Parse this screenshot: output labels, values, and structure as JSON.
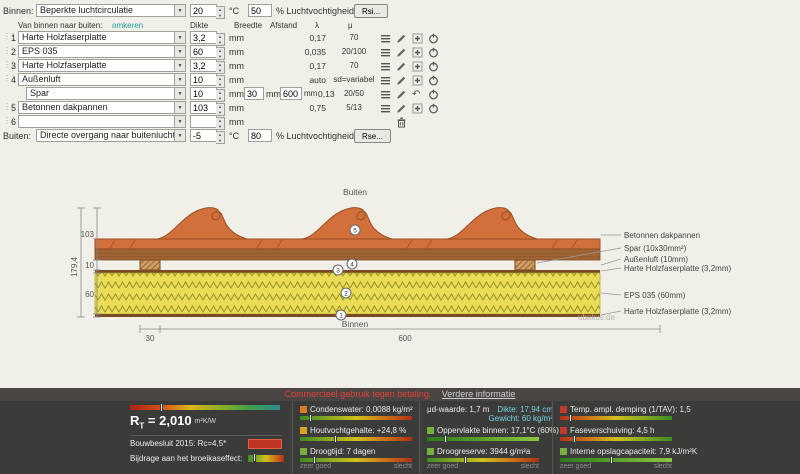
{
  "form": {
    "binnen": {
      "label": "Binnen:",
      "select": "Beperkte luchtcirculatie",
      "temp": "20",
      "temp_unit": "°C",
      "hum": "50",
      "hum_unit": "% Luchtvochtigheid",
      "btn": "Rsi..."
    },
    "buiten": {
      "label": "Buiten:",
      "select": "Directe overgang naar buitenlucht",
      "temp": "-5",
      "temp_unit": "°C",
      "hum": "80",
      "hum_unit": "% Luchtvochtigheid",
      "btn": "Rse..."
    },
    "header": {
      "left": "Van binnen naar buiten:",
      "omkeren": "omkeren",
      "dikte": "Dikte",
      "breedte": "Breedte",
      "afstand": "Afstand",
      "lambda": "λ",
      "mu": "μ"
    },
    "rows": [
      {
        "num": "1",
        "material": "Harte Holzfaserplatte",
        "dikte": "3,2",
        "unit": "mm",
        "lambda": "0,17",
        "mu": "70"
      },
      {
        "num": "2",
        "material": "EPS 035",
        "dikte": "60",
        "unit": "mm",
        "lambda": "0,035",
        "mu": "20/100"
      },
      {
        "num": "3",
        "material": "Harte Holzfaserplatte",
        "dikte": "3,2",
        "unit": "mm",
        "lambda": "0,17",
        "mu": "70"
      },
      {
        "num": "4",
        "material": "Außenluft",
        "dikte": "10",
        "unit": "mm",
        "lambda": "auto",
        "mu": "sd=variabel"
      },
      {
        "num": "",
        "material": "Spar",
        "dikte": "10",
        "unit": "mm",
        "breedte": "30",
        "breedte_unit": "mm",
        "afstand": "600",
        "afstand_unit": "mm",
        "lambda": "0,13",
        "mu": "20/50"
      },
      {
        "num": "5",
        "material": "Betonnen dakpannen",
        "dikte": "103",
        "unit": "mm",
        "lambda": "0,75",
        "mu": "5/13"
      },
      {
        "num": "6",
        "material": "",
        "dikte": "",
        "unit": "mm",
        "lambda": "",
        "mu": ""
      }
    ]
  },
  "diagram": {
    "buiten": "Buiten",
    "binnen": "Binnen",
    "watermark": "ubakus.de",
    "dim_103": "103",
    "dim_10": "10",
    "dim_60": "60",
    "dim_total": "179,4",
    "dim_30": "30",
    "dim_600": "600",
    "labels": [
      "Betonnen dakpannen",
      "Spar (10x30mm²)",
      "Außenluft (10mm)",
      "Harte Holzfaserplatte (3,2mm)",
      "EPS 035 (60mm)",
      "Harte Holzfaserplatte (3,2mm)"
    ],
    "markers": [
      "5",
      "4",
      "3",
      "2",
      "1"
    ]
  },
  "results": {
    "banner": "Commercieel gebruik tegen betaling.",
    "banner_link": "Verdere informatie",
    "rt_r": "R",
    "rt_t": "T",
    "rt_val": "= 2,010",
    "rt_unit": "m²K/W",
    "rt_marker": "20%",
    "bouwbesluit": "Bouwbesluit 2015: Rc=4,5*",
    "broeikas": "Bijdrage aan het broeikaseffect:",
    "broeikas_marker": "12%",
    "good": "zeer goed",
    "bad": "slecht",
    "accent_red": "#c03424",
    "accent_green": "#76b043",
    "col2": [
      {
        "label": "Condenswater: 0,0088 kg/m²",
        "status": "#d97e26",
        "scale": "gyr",
        "marker": "8%"
      },
      {
        "label": "Houtvochtgehalte: +24,8 %",
        "status": "#d9a426",
        "scale": "gyr",
        "marker": "30%"
      },
      {
        "label": "Droogtijd: 7 dagen",
        "status": "#76b043",
        "scale": "gyr",
        "marker": "12%"
      }
    ],
    "col3_texts": {
      "mud": "μd-waarde: 1,7 m",
      "dikte": "Dikte: 17,94 cm",
      "gewicht": "Gewicht: 60 kg/m²"
    },
    "col3": [
      {
        "label": "Oppervlakte binnen: 17,1°C (60%)",
        "status": "#76b043",
        "scale": "green",
        "marker": "15%"
      },
      {
        "label": "Droogreserve: 3944 g/m²a",
        "status": "#76b043",
        "scale": "gyr",
        "marker": "33%"
      }
    ],
    "col4": [
      {
        "label": "Temp. ampl. demping (1/TAV): 1,5",
        "status": "#c23a2b",
        "scale": "ryg",
        "marker": "8%"
      },
      {
        "label": "Faseverschuiving: 4,5 h",
        "status": "#c23a2b",
        "scale": "ryg",
        "marker": "12%"
      },
      {
        "label": "Interne opslagcapaciteit: 7,9 kJ/m²K",
        "status": "#76b043",
        "scale": "green",
        "marker": "45%"
      }
    ]
  }
}
